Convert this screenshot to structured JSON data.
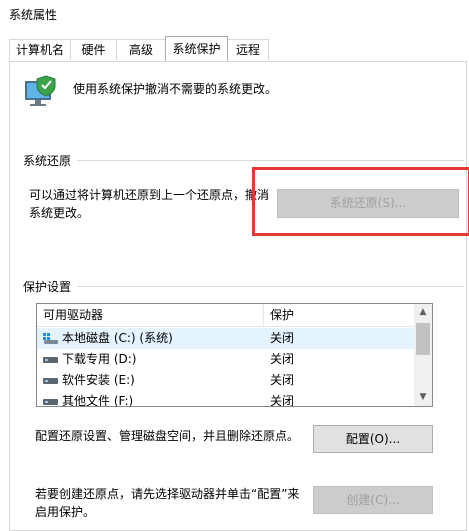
{
  "window": {
    "title": "系统属性"
  },
  "tabs": [
    {
      "label": "计算机名",
      "active": false
    },
    {
      "label": "硬件",
      "active": false
    },
    {
      "label": "高级",
      "active": false
    },
    {
      "label": "系统保护",
      "active": true
    },
    {
      "label": "远程",
      "active": false
    }
  ],
  "header": {
    "icon": "computer-shield-icon",
    "text": "使用系统保护撤消不需要的系统更改。"
  },
  "restore": {
    "section_title": "系统还原",
    "description": "可以通过将计算机还原到上一个还原点，撤消系统更改。",
    "description_line1": "可以通过将计算机还原到上一个还原点，撤消",
    "description_line2": "系统更改。",
    "button_label": "系统还原(S)...",
    "button_enabled": false,
    "highlight_color": "#e53935"
  },
  "protection": {
    "section_title": "保护设置",
    "columns": [
      "可用驱动器",
      "保护"
    ],
    "drives": [
      {
        "name": "本地磁盘 (C:) (系统)",
        "protection": "关闭",
        "icon": "system-drive-icon",
        "selected": true
      },
      {
        "name": "下载专用 (D:)",
        "protection": "关闭",
        "icon": "drive-icon",
        "selected": false
      },
      {
        "name": "软件安装 (E:)",
        "protection": "关闭",
        "icon": "drive-icon",
        "selected": false
      },
      {
        "name": "其他文件 (F:)",
        "protection": "关闭",
        "icon": "drive-icon",
        "selected": false
      }
    ],
    "configure_text": "配置还原设置、管理磁盘空间，并且删除还原点。",
    "configure_button": "配置(O)...",
    "create_text_line1": "若要创建还原点，请先选择驱动器并单击“配置”来",
    "create_text_line2": "启用保护。",
    "create_button": "创建(C)...",
    "create_enabled": false
  }
}
